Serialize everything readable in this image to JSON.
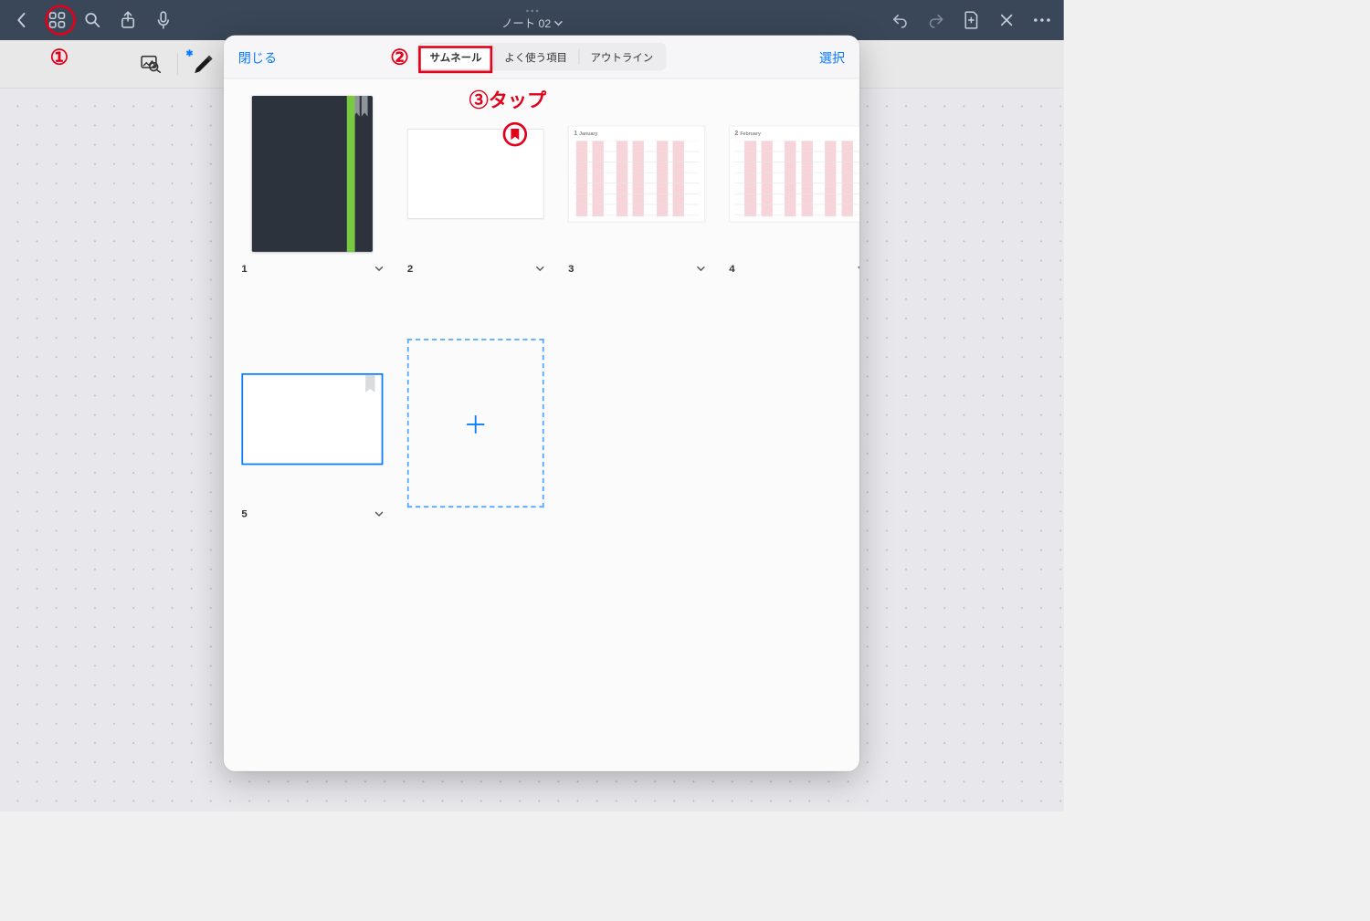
{
  "nav": {
    "doc_title": "ノート 02"
  },
  "popover": {
    "close": "閉じる",
    "select": "選択",
    "tabs": {
      "thumb": "サムネール",
      "fav": "よく使う項目",
      "outline": "アウトライン"
    }
  },
  "pages": {
    "p1": "1",
    "p2": "2",
    "p3": "3",
    "p4": "4",
    "p5": "5",
    "month3_num": "1",
    "month3_name": "January",
    "month4_num": "2",
    "month4_name": "February"
  },
  "add_symbol": "＋",
  "anno": {
    "n1": "①",
    "n2": "②",
    "n3": "③",
    "tap": "タップ"
  }
}
